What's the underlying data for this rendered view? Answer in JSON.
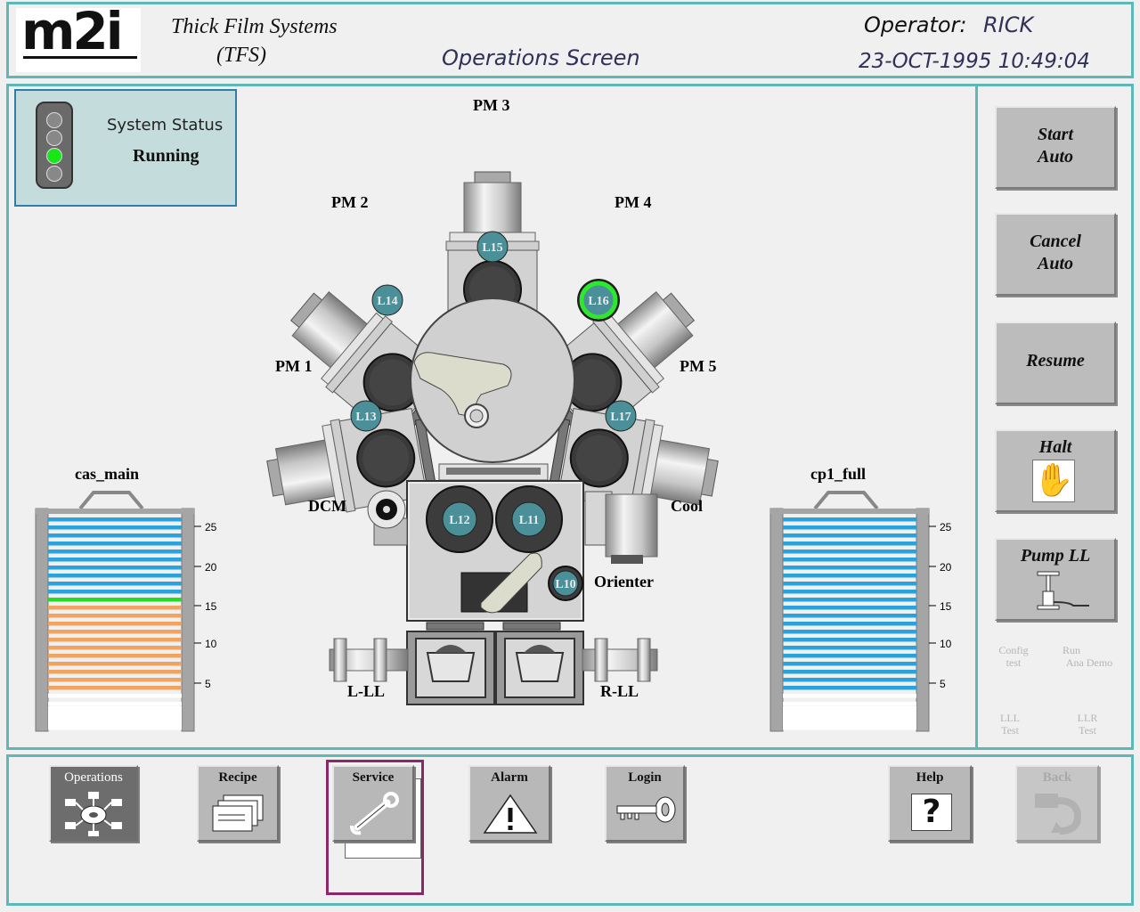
{
  "header": {
    "logo": "m2i",
    "product_line1": "Thick Film Systems",
    "product_line2": "(TFS)",
    "screen_title": "Operations Screen",
    "operator_label": "Operator:",
    "operator_name": "RICK",
    "datetime": "23-OCT-1995 10:49:04"
  },
  "status": {
    "label": "System Status",
    "value": "Running",
    "light": "green"
  },
  "tool": {
    "modules": {
      "pm1": "PM 1",
      "pm2": "PM 2",
      "pm3": "PM 3",
      "pm4": "PM 4",
      "pm5": "PM 5",
      "dcm": "DCM",
      "cool": "Cool",
      "orienter": "Orienter",
      "lll": "L-LL",
      "rll": "R-LL"
    },
    "locations": {
      "l10": "L10",
      "l11": "L11",
      "l12": "L12",
      "l13": "L13",
      "l14": "L14",
      "l15": "L15",
      "l16": "L16",
      "l17": "L17"
    },
    "active_location": "L16"
  },
  "cassettes": {
    "left": {
      "name": "cas_main",
      "ticks": [
        "25",
        "20",
        "15",
        "10",
        "5"
      ],
      "slots_total": 27,
      "slots": "blue slots 16-25, green slot 15, orange slots 4-14, white slots 1-3"
    },
    "right": {
      "name": "cp1_full",
      "ticks": [
        "25",
        "20",
        "15",
        "10",
        "5"
      ],
      "slots_total": 27,
      "slots": "blue slots 4-25, white slots 1-3"
    }
  },
  "actions": {
    "start_auto": [
      "Start",
      "Auto"
    ],
    "cancel_auto": [
      "Cancel",
      "Auto"
    ],
    "resume": "Resume",
    "halt": "Halt",
    "pump_ll": "Pump LL",
    "config_test": [
      "Config",
      "test"
    ],
    "run_ana_demo": [
      "Run",
      "Ana Demo"
    ],
    "lll_test": [
      "LLL",
      "Test"
    ],
    "llr_test": [
      "LLR",
      "Test"
    ]
  },
  "nav": {
    "operations": "Operations",
    "recipe": "Recipe",
    "service": "Service",
    "alarm": "Alarm",
    "login": "Login",
    "help": "Help",
    "back": "Back"
  },
  "colors": {
    "frame": "#5fb8b8",
    "blue_slot": "#2aa3dc",
    "orange_slot": "#f0a460",
    "green_slot": "#22dd22",
    "active_ring": "#2ee82e",
    "service_highlight": "#8b2868"
  }
}
